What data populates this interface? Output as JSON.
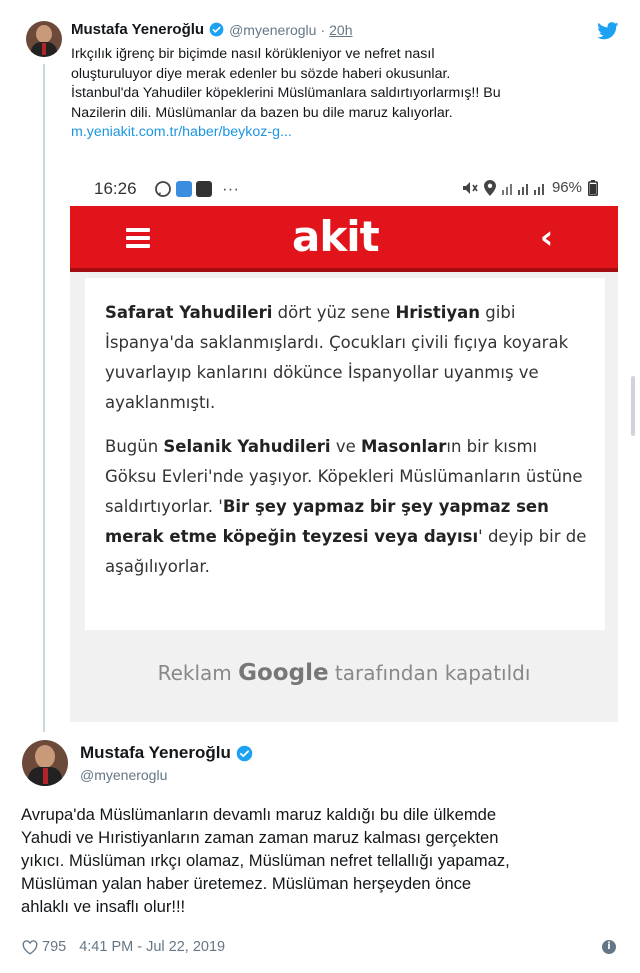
{
  "tweet1": {
    "author_name": "Mustafa Yeneroğlu",
    "handle": "@myeneroglu",
    "separator": "·",
    "time": "20h",
    "text_lines": [
      "Irkçılık iğrenç bir biçimde nasıl körükleniyor ve nefret nasıl",
      "oluşturuluyor diye merak edenler bu sözde haberi okusunlar.",
      "İstanbul'da Yahudiler köpeklerini Müslümanlara saldırtıyorlarmış!! Bu",
      "Nazilerin dili. Müslümanlar da bazen bu dile maruz kalıyorlar."
    ],
    "link": "m.yeniakit.com.tr/haber/beykoz-g..."
  },
  "embed": {
    "phone_time": "16:26",
    "status_dots": "···",
    "battery": "96%",
    "brand": "akit",
    "back_symbol": "‹",
    "paragraph1": {
      "b1": "Safarat Yahudileri",
      "t1": " dört yüz sene ",
      "b2": "Hristiyan",
      "t2": " gibi İspanya'da saklanmışlardı. Çocukları çivili fıçıya koyarak yuvarlayıp kanlarını dökünce İspanyollar uyanmış ve ayaklanmıştı."
    },
    "paragraph2": {
      "t1": "Bugün ",
      "b1": "Selanik Yahudileri",
      "t2": " ve ",
      "b2": "Masonlar",
      "t3": "ın bir kısmı Göksu Evleri'nde yaşıyor. Köpekleri Müslümanların üstüne saldırtıyorlar. '",
      "b3": "Bir şey yapmaz bir şey yapmaz sen merak etme köpeğin teyzesi veya dayısı",
      "t4": "' deyip bir de aşağılıyorlar."
    },
    "ad_prefix": "Reklam ",
    "ad_google": "Google",
    "ad_suffix": " tarafından kapatıldı"
  },
  "tweet2": {
    "author_name": "Mustafa Yeneroğlu",
    "handle": "@myeneroglu",
    "text_lines": [
      "Avrupa'da Müslümanların devamlı maruz kaldığı bu dile ülkemde",
      "Yahudi ve Hıristiyanların zaman zaman maruz kalması gerçekten",
      "yıkıcı. Müslüman ırkçı olamaz, Müslüman nefret tellallığı yapamaz,",
      "Müslüman yalan haber üretemez. Müslüman herşeyden önce",
      "ahlaklı ve insaflı olur!!!"
    ],
    "likes": "795",
    "timestamp": "4:41 PM - Jul 22, 2019",
    "info_symbol": "i"
  },
  "colors": {
    "twitter_blue": "#1da1f2",
    "akit_red": "#e2141b",
    "text_gray": "#657786"
  },
  "icons": [
    "verified-icon",
    "twitter-bird-icon",
    "hamburger-icon",
    "back-arrow-icon",
    "heart-icon",
    "info-icon"
  ]
}
